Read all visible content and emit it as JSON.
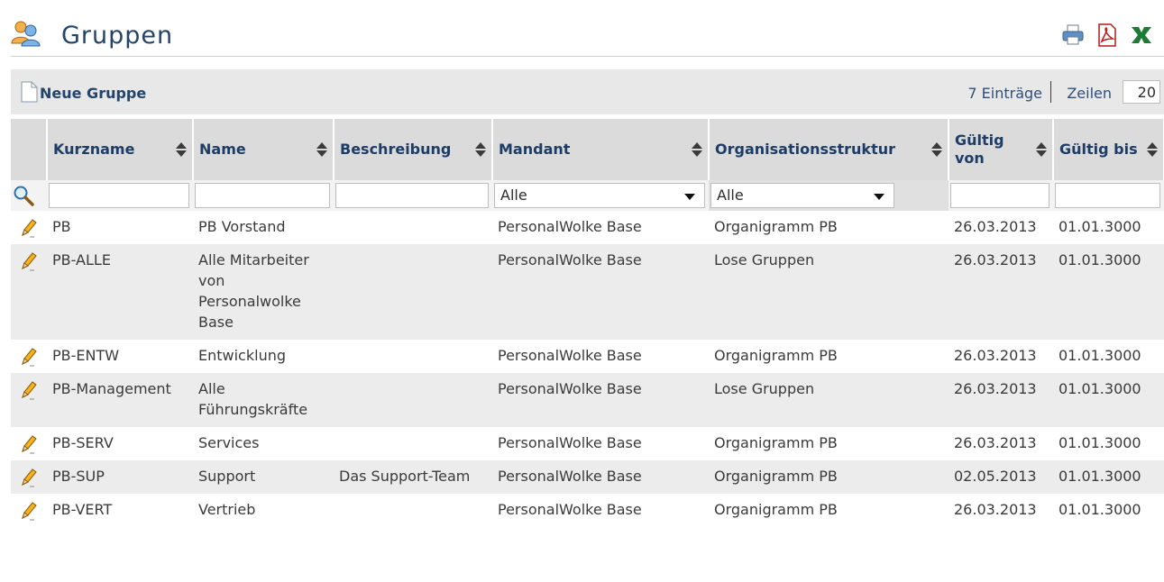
{
  "page": {
    "title": "Gruppen"
  },
  "toolbar": {
    "new_group_label": "Neue Gruppe",
    "entries_count": "7 Einträge",
    "rows_label": "Zeilen",
    "rows_value": "20"
  },
  "exports": [
    "print-icon",
    "pdf-icon",
    "excel-icon"
  ],
  "columns": {
    "kurzname": "Kurzname",
    "name": "Name",
    "beschreibung": "Beschreibung",
    "mandant": "Mandant",
    "organisationsstruktur": "Organisationsstruktur",
    "gueltig_von": "Gültig von",
    "gueltig_bis": "Gültig bis"
  },
  "filters": {
    "mandant": "Alle",
    "organisationsstruktur": "Alle"
  },
  "rows": [
    {
      "kurzname": "PB",
      "name": "PB Vorstand",
      "beschreibung": "",
      "mandant": "PersonalWolke Base",
      "organisationsstruktur": "Organigramm PB",
      "gueltig_von": "26.03.2013",
      "gueltig_bis": "01.01.3000"
    },
    {
      "kurzname": "PB-ALLE",
      "name": "Alle Mitarbeiter von Personalwolke Base",
      "beschreibung": "",
      "mandant": "PersonalWolke Base",
      "organisationsstruktur": "Lose Gruppen",
      "gueltig_von": "26.03.2013",
      "gueltig_bis": "01.01.3000"
    },
    {
      "kurzname": "PB-ENTW",
      "name": "Entwicklung",
      "beschreibung": "",
      "mandant": "PersonalWolke Base",
      "organisationsstruktur": "Organigramm PB",
      "gueltig_von": "26.03.2013",
      "gueltig_bis": "01.01.3000"
    },
    {
      "kurzname": "PB-Management",
      "name": "Alle Führungskräfte",
      "beschreibung": "",
      "mandant": "PersonalWolke Base",
      "organisationsstruktur": "Lose Gruppen",
      "gueltig_von": "26.03.2013",
      "gueltig_bis": "01.01.3000"
    },
    {
      "kurzname": "PB-SERV",
      "name": "Services",
      "beschreibung": "",
      "mandant": "PersonalWolke Base",
      "organisationsstruktur": "Organigramm PB",
      "gueltig_von": "26.03.2013",
      "gueltig_bis": "01.01.3000"
    },
    {
      "kurzname": "PB-SUP",
      "name": "Support",
      "beschreibung": "Das Support-Team",
      "mandant": "PersonalWolke Base",
      "organisationsstruktur": "Organigramm PB",
      "gueltig_von": "02.05.2013",
      "gueltig_bis": "01.01.3000"
    },
    {
      "kurzname": "PB-VERT",
      "name": "Vertrieb",
      "beschreibung": "",
      "mandant": "PersonalWolke Base",
      "organisationsstruktur": "Organigramm PB",
      "gueltig_von": "26.03.2013",
      "gueltig_bis": "01.01.3000"
    }
  ]
}
